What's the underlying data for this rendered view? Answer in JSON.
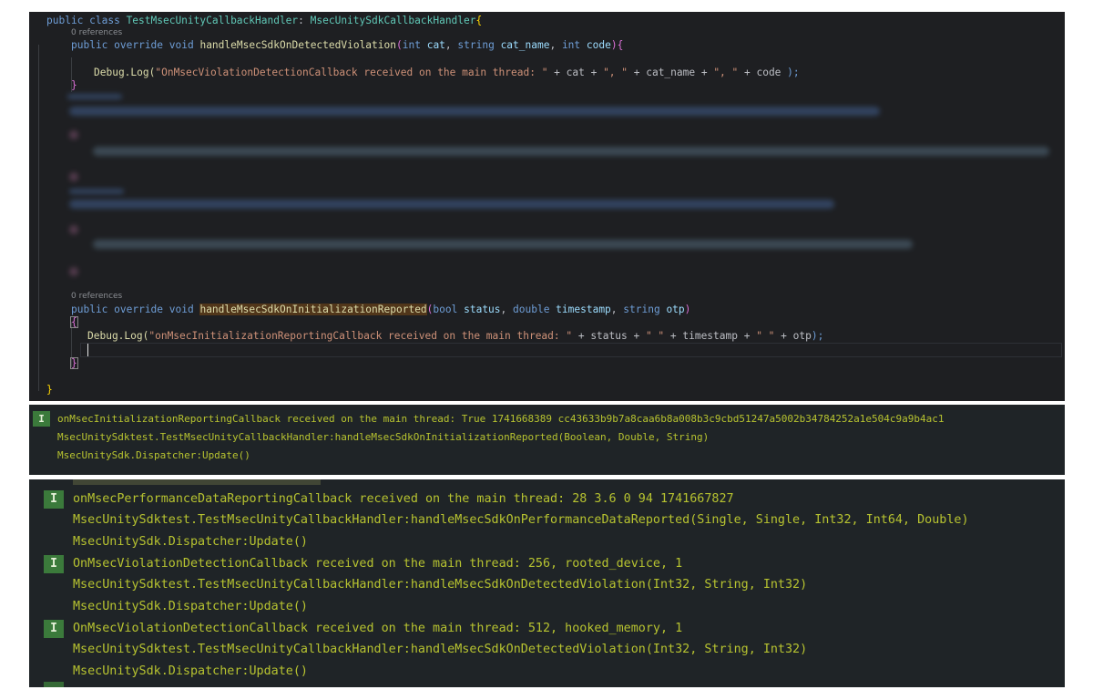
{
  "editor": {
    "class_decl": {
      "kw": "public class ",
      "name": "TestMsecUnityCallbackHandler",
      "colon": ": ",
      "base": "MsecUnitySdkCallbackHandler",
      "brace": "{"
    },
    "refs_label": "0 references",
    "method1": {
      "kw": "public override void ",
      "name": "handleMsecSdkOnDetectedViolation",
      "open": "(",
      "p1_type": "int ",
      "p1": "cat",
      "sep1": ", ",
      "p2_type": "string ",
      "p2": "cat_name",
      "sep2": ", ",
      "p3_type": "int ",
      "p3": "code",
      "close": "){",
      "body_call": "Debug.Log(",
      "body_str": "\"OnMsecViolationDetectionCallback received on the main thread: \"",
      "body_rest1": " + cat + ",
      "body_str2": "\", \"",
      "body_rest2": " + cat_name + ",
      "body_str3": "\", \"",
      "body_rest3": " + code ",
      "body_end": ");",
      "end_brace": "}"
    },
    "method2": {
      "kw": "public override void ",
      "name": "handleMsecSdkOnInitializationReported",
      "open": "(",
      "p1_type": "bool ",
      "p1": "status",
      "sep1": ", ",
      "p2_type": "double ",
      "p2": "timestamp",
      "sep2": ", ",
      "p3_type": "string ",
      "p3": "otp",
      "close": ")",
      "open_brace": "{",
      "body_call": "Debug.Log(",
      "body_str": "\"onMsecInitializationReportingCallback received on the main thread: \"",
      "body_rest1": " + status + ",
      "body_str2": "\" \"",
      "body_rest2": " + timestamp + ",
      "body_str3": "\" \"",
      "body_rest3": " + otp",
      "body_end": ");",
      "end_brace": "}"
    },
    "class_end": "}"
  },
  "console1": {
    "badge": "I",
    "lines": [
      "onMsecInitializationReportingCallback received on the main thread: True 1741668389 cc43633b9b7a8caa6b8a008b3c9cbd51247a5002b34784252a1e504c9a9b4ac1",
      "MsecUnitySdktest.TestMsecUnityCallbackHandler:handleMsecSdkOnInitializationReported(Boolean, Double, String)",
      "MsecUnitySdk.Dispatcher:Update()"
    ]
  },
  "console2": {
    "entries": [
      {
        "badge": "I",
        "lines": [
          "onMsecPerformanceDataReportingCallback received on the main thread: 28 3.6 0 94 1741667827",
          "MsecUnitySdktest.TestMsecUnityCallbackHandler:handleMsecSdkOnPerformanceDataReported(Single, Single, Int32, Int64, Double)",
          "MsecUnitySdk.Dispatcher:Update()"
        ]
      },
      {
        "badge": "I",
        "lines": [
          "OnMsecViolationDetectionCallback received on the main thread: 256, rooted_device, 1",
          "MsecUnitySdktest.TestMsecUnityCallbackHandler:handleMsecSdkOnDetectedViolation(Int32, String, Int32)",
          "MsecUnitySdk.Dispatcher:Update()"
        ]
      },
      {
        "badge": "I",
        "lines": [
          "OnMsecViolationDetectionCallback received on the main thread: 512, hooked_memory, 1",
          "MsecUnitySdktest.TestMsecUnityCallbackHandler:handleMsecSdkOnDetectedViolation(Int32, String, Int32)",
          "MsecUnitySdk.Dispatcher:Update()"
        ]
      }
    ]
  }
}
